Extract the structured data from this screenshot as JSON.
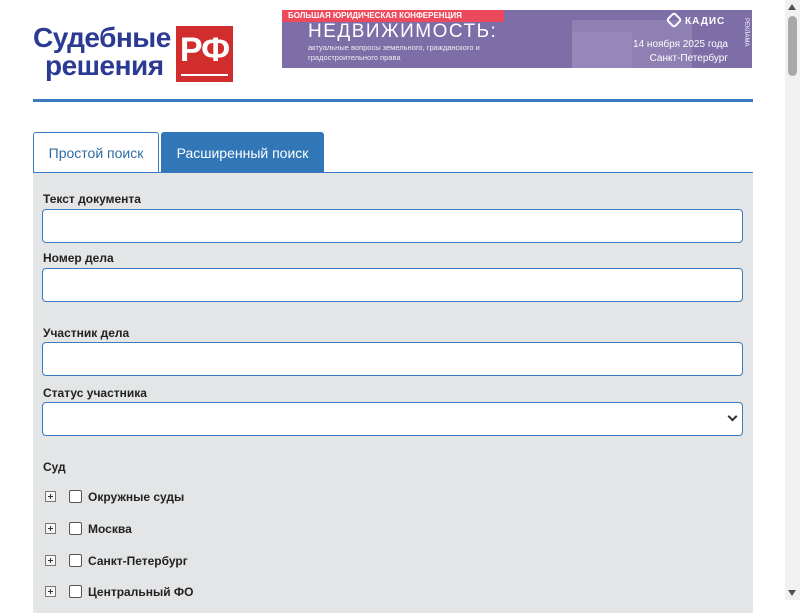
{
  "header": {
    "logo": {
      "line1": "Судебные",
      "line2": "решения",
      "badge": "РФ"
    },
    "banner": {
      "top_label": "БОЛЬШАЯ ЮРИДИЧЕСКАЯ КОНФЕРЕНЦИЯ",
      "title": "НЕДВИЖИМОСТЬ:",
      "subtitle": "актуальные вопросы земельного, гражданского и градостроительного права",
      "brand": "КАДИС",
      "date": "14 ноября 2025 года",
      "city": "Санкт-Петербург",
      "ad_mark": "РЕКЛАМА"
    }
  },
  "tabs": [
    {
      "label": "Простой поиск",
      "active": false
    },
    {
      "label": "Расширенный поиск",
      "active": true
    }
  ],
  "form": {
    "document_text": {
      "label": "Текст документа",
      "value": ""
    },
    "case_number": {
      "label": "Номер дела",
      "value": ""
    },
    "participant": {
      "label": "Участник дела",
      "value": ""
    },
    "participant_status": {
      "label": "Статус участника",
      "value": ""
    },
    "court": {
      "label": "Суд",
      "items": [
        "Окружные суды",
        "Москва",
        "Санкт-Петербург",
        "Центральный ФО"
      ]
    }
  },
  "colors": {
    "accent": "#3176b6",
    "brand_blue": "#2b3a92",
    "brand_red": "#d12d2d",
    "panel_bg": "#e3e5e7",
    "banner_bg": "#7e6ea8"
  }
}
